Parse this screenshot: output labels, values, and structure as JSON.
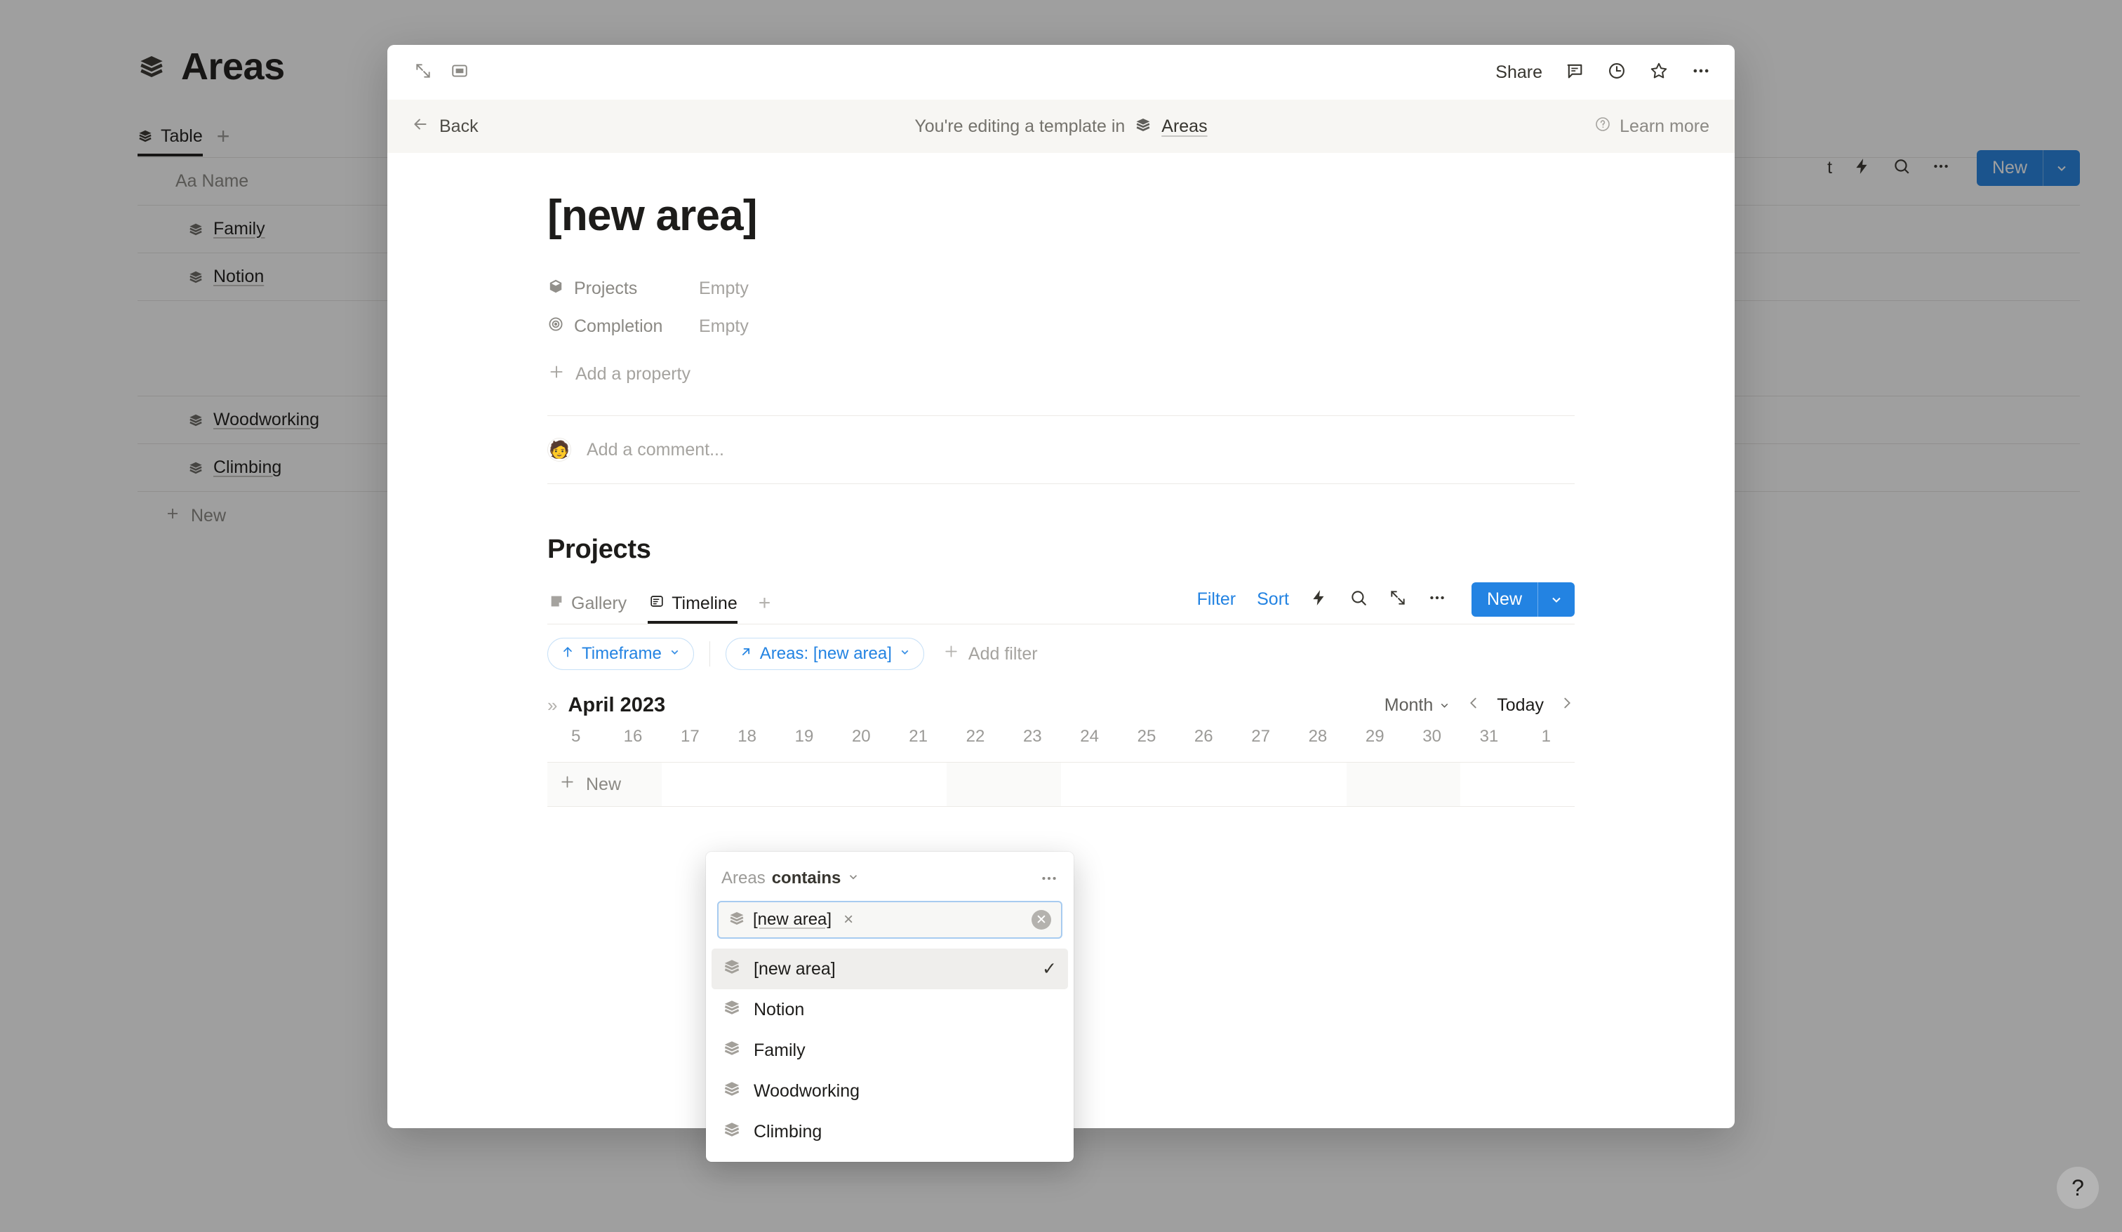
{
  "background": {
    "title": "Areas",
    "icon": "stack-icon",
    "view_tabs": [
      {
        "label": "Table",
        "icon": "stack-icon",
        "active": true
      }
    ],
    "add_view_label": "+",
    "toolbar": {
      "partial_label": "t",
      "icons": [
        "lightning-icon",
        "search-icon",
        "more-horizontal-icon"
      ],
      "new_label": "New",
      "new_caret": "⌄"
    },
    "table": {
      "columns": [
        "Aa Name"
      ],
      "column_icon": "text-type-icon",
      "rows": [
        {
          "name": "Family",
          "icon": "stack-icon"
        },
        {
          "name": "Notion",
          "icon": "stack-icon"
        },
        {
          "name": "",
          "icon": "",
          "spacer": true
        },
        {
          "name": "Woodworking",
          "icon": "stack-icon"
        },
        {
          "name": "Climbing",
          "icon": "stack-icon"
        }
      ],
      "new_row_label": "New"
    }
  },
  "help_button": {
    "label": "?",
    "icon": "question-mark-icon"
  },
  "modal": {
    "topbar": {
      "expand_icon": "expand-diagonal-icon",
      "sidepeek_icon": "side-peek-icon",
      "share_label": "Share",
      "comment_icon": "comment-icon",
      "history_icon": "clock-history-icon",
      "favorite_icon": "star-icon",
      "more_icon": "more-horizontal-icon"
    },
    "banner": {
      "back_label": "Back",
      "back_icon": "arrow-left-icon",
      "message": "You're editing a template in",
      "database_name": "Areas",
      "database_icon": "stack-icon",
      "learn_more_label": "Learn more",
      "learn_more_icon": "question-circle-icon"
    },
    "page": {
      "title": "[new area]",
      "properties": [
        {
          "name": "Projects",
          "icon": "relation-icon",
          "value": "Empty"
        },
        {
          "name": "Completion",
          "icon": "rollup-target-icon",
          "value": "Empty"
        }
      ],
      "add_property_label": "Add a property",
      "add_property_icon": "plus-icon",
      "comment_placeholder": "Add a comment...",
      "comment_avatar": "user-avatar"
    },
    "database_block": {
      "title": "Projects",
      "view_tabs": [
        {
          "label": "Gallery",
          "icon": "gallery-icon",
          "active": false
        },
        {
          "label": "Timeline",
          "icon": "timeline-icon",
          "active": true
        }
      ],
      "add_view_label": "+",
      "tools": {
        "filter_label": "Filter",
        "sort_label": "Sort",
        "automation_icon": "lightning-icon",
        "search_icon": "search-icon",
        "expand_icon": "expand-diagonal-icon",
        "more_icon": "more-horizontal-icon",
        "new_label": "New",
        "new_caret": "⌄"
      },
      "filters": [
        {
          "label": "Timeframe",
          "icon": "sort-up-arrow-icon",
          "caret": "⌄"
        },
        {
          "label": "Areas: [new area]",
          "icon": "relation-arrow-icon",
          "caret": "⌄"
        }
      ],
      "add_filter_label": "Add filter",
      "add_filter_icon": "plus-icon",
      "timeline": {
        "expand_chevrons": "»",
        "month_label": "April 2023",
        "zoom_label": "Month",
        "zoom_caret": "⌄",
        "prev_icon": "chevron-left-icon",
        "today_label": "Today",
        "next_icon": "chevron-right-icon",
        "dates": [
          "5",
          "16",
          "17",
          "18",
          "19",
          "20",
          "21",
          "22",
          "23",
          "24",
          "25",
          "26",
          "27",
          "28",
          "29",
          "30",
          "31",
          "1"
        ],
        "weekend_indices": [
          0,
          1,
          7,
          8,
          14,
          15
        ],
        "new_row_label": "New",
        "new_row_icon": "plus-icon"
      }
    }
  },
  "filter_popup": {
    "property_label": "Areas",
    "condition_label": "contains",
    "condition_caret": "⌄",
    "more_icon": "more-horizontal-icon",
    "input": {
      "token_label": "[new area]",
      "token_icon": "stack-icon",
      "token_remove": "×",
      "clear_icon": "clear-circle-icon"
    },
    "options": [
      {
        "label": "[new area]",
        "icon": "stack-icon",
        "selected": true,
        "check": "✓"
      },
      {
        "label": "Notion",
        "icon": "stack-icon",
        "selected": false,
        "check": ""
      },
      {
        "label": "Family",
        "icon": "stack-icon",
        "selected": false,
        "check": ""
      },
      {
        "label": "Woodworking",
        "icon": "stack-icon",
        "selected": false,
        "check": ""
      },
      {
        "label": "Climbing",
        "icon": "stack-icon",
        "selected": false,
        "check": ""
      }
    ]
  },
  "colors": {
    "accent_blue": "#2383e2",
    "chip_border": "#c7e0f7",
    "banner_bg": "#f7f6f3",
    "text_primary": "#1d1c1a",
    "text_muted": "#8b8984",
    "selected_row": "#efeeec",
    "overlay": "rgba(15,15,15,0.40)"
  }
}
